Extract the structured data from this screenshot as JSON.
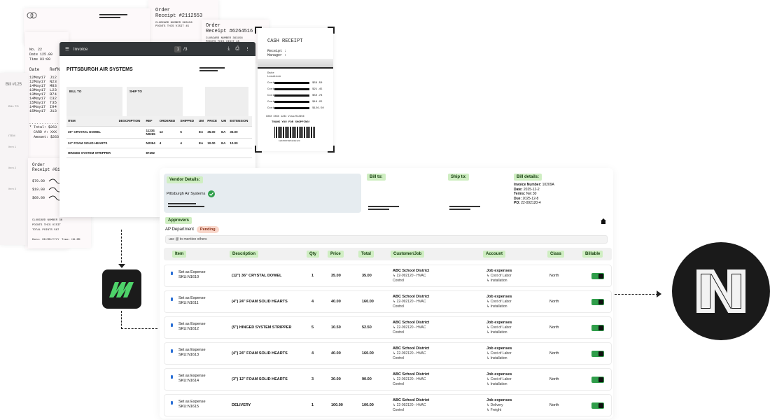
{
  "receipts": {
    "order_a_title": "Order",
    "order_a_receipt": "Receipt #2112553",
    "order_a_card": "CLUBCARD NUMBER 363156",
    "order_a_points": "POINTS THIS VISIT 45",
    "order_b_title": "Order",
    "order_b_receipt": "Receipt #6264516",
    "order_b_card": "CLUBCARD NUMBER 363156",
    "order_b_points": "POINTS THIS VISIT 45",
    "bill_label": "Bill #125",
    "bill_to": "BILL TO",
    "item_label": "ITEM",
    "item_1": "Item 1",
    "item_2": "Item 2",
    "item_3": "Item 3",
    "tally": "No. 22\nDate 125.00\nTime 03:00",
    "date_head": "Date",
    "ref_head": "RefNu",
    "dates": [
      "12May17",
      "12May17",
      "14May17",
      "13May17",
      "13May17",
      "14May17",
      "15May17",
      "14May17",
      "15May17"
    ],
    "refs": [
      "J12",
      "N23",
      "M83",
      "L23",
      "R74",
      "C32",
      "T35",
      "I94",
      "J13"
    ],
    "totals": "* Total: $263\n  CARD #: XXX\n  Amount: $263",
    "order_c_title": "Order",
    "order_c_receipt": "Receipt #6174",
    "order_c_amounts": [
      "$79.00",
      "$19.00",
      "$69.00"
    ],
    "order_c_card": "CLUBCARD NUMBER 36\nPOINTS THIS VISIT\nTOTAL POINTS 567",
    "order_c_date": "Date: DD/MM/YYYY",
    "order_c_time": "Time: HH:MM"
  },
  "pdf_viewer": {
    "title": "Invoice",
    "page_current": "1",
    "page_total": "/3",
    "company": "PITTSBURGH AIR SYSTEMS",
    "bill_to": "BILL TO",
    "ship_to": "SHIP TO",
    "columns": [
      "ITEM",
      "DESCRIPTION",
      "REF",
      "ORDERED",
      "SHIPPED",
      "UM",
      "PRICE",
      "UM",
      "EXTENSION"
    ],
    "rows": [
      [
        "36\" CRYSTAL DOWEL",
        "",
        "11234\nN0265",
        "12",
        "5",
        "EA",
        "35.00",
        "EA",
        "35.00"
      ],
      [
        "24\" FOAM SOLID HEARTS",
        "",
        "N2394",
        "4",
        "4",
        "EA",
        "10.00",
        "EA",
        "10.00"
      ],
      [
        "HINGED SYSTEM STRIPPER",
        "",
        "87492",
        "",
        "",
        "",
        "",
        "",
        ""
      ]
    ]
  },
  "cash_receipt": {
    "title": "CASH RECEIPT",
    "receipt_label": "Receipt :",
    "manager_label": "Manager :",
    "date_label": "Date",
    "location_label": "Location",
    "cost_label": "Cost",
    "amounts": [
      "$56.50",
      "$21.45",
      "$50.78",
      "$16.25",
      "$126.50"
    ],
    "footer": "XXXX XXXX 1234 Visa/012456",
    "thanks": "THANK YOU FOR SHOPPING!",
    "barcode_number": "12345678954818123"
  },
  "app": {
    "vendor_label": "Vendor Details:",
    "vendor_name": "Pittsburgh Air Systems",
    "bill_to_label": "Bill to:",
    "ship_to_label": "Ship to:",
    "bill_details_label": "Bill details:",
    "invoice_number_label": "Invoice Number:",
    "invoice_number": "10209A",
    "date_label": "Date:",
    "date": "2025-12-2",
    "terms_label": "Terms:",
    "terms": "Net 30",
    "due_label": "Due:",
    "due": "2025-12-8",
    "po_label": "PO:",
    "po": "22-092120-4",
    "approvers_label": "Approvers",
    "approver_dept": "AP Department",
    "approver_status": "Pending",
    "mention_placeholder": "use @ to mention others",
    "columns": {
      "item": "Item",
      "description": "Description",
      "qty": "Qty",
      "price": "Price",
      "total": "Total",
      "customer_job": "Customer/Job",
      "account": "Account",
      "class": "Class",
      "billable": "Billable"
    },
    "rows": [
      {
        "item": "Set as Expense",
        "sku": "SKU:N1610",
        "description": "(12\") 36\" CRYSTAL DOWEL",
        "qty": "1",
        "price": "35.00",
        "total": "35.00",
        "customer": "ABC School District",
        "job": "22-092120 - HVAC",
        "job2": "Control",
        "account": "Job expenses",
        "account2": "Cost of Labor",
        "account3": "Installation",
        "class": "North"
      },
      {
        "item": "Set as Expense",
        "sku": "SKU:N1611",
        "description": "(4\") 24\" FOAM SOLID HEARTS",
        "qty": "4",
        "price": "40.00",
        "total": "160.00",
        "customer": "ABC School District",
        "job": "22-092120 - HVAC",
        "job2": "Control",
        "account": "Job expenses",
        "account2": "Cost of Labor",
        "account3": "Installation",
        "class": "North"
      },
      {
        "item": "Set as Expense",
        "sku": "SKU:N1612",
        "description": "(5\") HINGED SYSTEM STRIPPER",
        "qty": "5",
        "price": "10.50",
        "total": "52.50",
        "customer": "ABC School District",
        "job": "22-092120 - HVAC",
        "job2": "Control",
        "account": "Job expenses",
        "account2": "Cost of Labor",
        "account3": "Installation",
        "class": "North"
      },
      {
        "item": "Set as Expense",
        "sku": "SKU:N1613",
        "description": "(4\") 24\" FOAM SOLID HEARTS",
        "qty": "4",
        "price": "40.00",
        "total": "160.00",
        "customer": "ABC School District",
        "job": "22-092120 - HVAC",
        "job2": "Control",
        "account": "Job expenses",
        "account2": "Cost of Labor",
        "account3": "Installation",
        "class": "North"
      },
      {
        "item": "Set as Expense",
        "sku": "SKU:N1614",
        "description": "(3\") 12\" FOAM SOLID HEARTS",
        "qty": "3",
        "price": "30.00",
        "total": "90.00",
        "customer": "ABC School District",
        "job": "22-092120 - HVAC",
        "job2": "Control",
        "account": "Job expenses",
        "account2": "Cost of Labor",
        "account3": "Installation",
        "class": "North"
      },
      {
        "item": "Set as Expense",
        "sku": "SKU:N1615",
        "description": "DELIVERY",
        "qty": "1",
        "price": "100.00",
        "total": "100.00",
        "customer": "ABC School District",
        "job": "22-092120 - HVAC",
        "job2": "Control",
        "account": "Job expenses",
        "account2": "Delivery",
        "account3": "Freight",
        "class": "North"
      }
    ]
  },
  "icons": {
    "brand_source": "m-logo-icon",
    "brand_target": "n-logo-icon",
    "verified": "check-circle-icon",
    "billable_toggle": "toggle-on-icon"
  },
  "colors": {
    "chip_bg": "#cfeec2",
    "pending_bg": "#f9d8cc",
    "toggle": "#2f9e4a",
    "m_logo_green": "#4ed36a",
    "vendor_card": "#e6ecf0"
  }
}
